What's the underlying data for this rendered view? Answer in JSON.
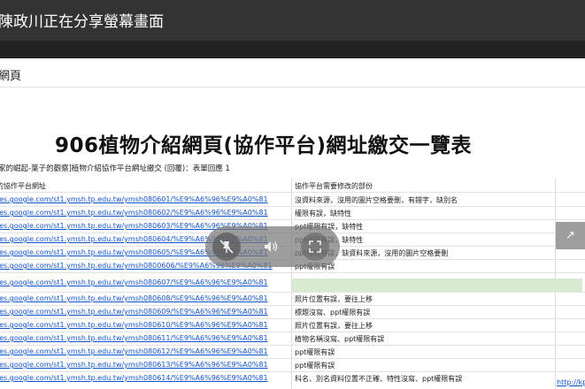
{
  "meeting": {
    "share_banner": "陳政川正在分享螢幕畫面"
  },
  "page": {
    "label": "網頁",
    "heading": "906植物介紹網頁(協作平台)網址繳交一覽表",
    "sheet_caption": "家的崛起-葉子的觀察]植物介紹協作平台網址繳交 (回覆)：表單回應 1"
  },
  "table": {
    "headers": [
      "的協作平台網址",
      "協作平台需要修改的部份"
    ],
    "rows": [
      {
        "url": "tes.google.com/st1.ymsh.tp.edu.tw/ymsh080601/%E9%A6%96%E9%A0%81",
        "note": "沒資料來源，沒用的圖片空格要刪，有錯字，缺別名"
      },
      {
        "url": "tes.google.com/st1.ymsh.tp.edu.tw/ymsh080602/%E9%A6%96%E9%A0%81",
        "note": "權限有誤，缺特性"
      },
      {
        "url": "tes.google.com/st1.ymsh.tp.edu.tw/ymsh080603/%E9%A6%96%E9%A0%81",
        "note": "ppt權限有誤，缺特性"
      },
      {
        "url": "tes.google.com/st1.ymsh.tp.edu.tw/ymsh080604/%E9%A6%96%E9%A0%81",
        "note": "ppt權限有誤，缺特性"
      },
      {
        "url": "tes.google.com/st1.ymsh.tp.edu.tw/ymsh080605/%E9%A6%96%E9%A0%81",
        "note": "ppt權限有誤，缺資料來源，沒用的圖片空格要刪"
      },
      {
        "url": "tes.google.com/st1.ymsh.tp.edu.tw/ymsh0800606/%E9%A6%96%E9%A0%81",
        "note": "ppt權限有誤"
      },
      {
        "url": "tes.google.com/st1.ymsh.tp.edu.tw/ymsh080607/%E9%A6%96%E9%A0%81",
        "note": ""
      },
      {
        "url": "tes.google.com/st1.ymsh.tp.edu.tw/ymsh080608/%E9%A6%96%E9%A0%81",
        "note": "照片位置有誤，要往上移"
      },
      {
        "url": "tes.google.com/st1.ymsh.tp.edu.tw/ymsh080609/%E9%A6%96%E9%A0%81",
        "note": "標題沒寫、ppt權限有誤"
      },
      {
        "url": "tes.google.com/st1.ymsh.tp.edu.tw/ymsh080610/%E9%A6%96%E9%A0%81",
        "note": "照片位置有誤，要往上移"
      },
      {
        "url": "tes.google.com/st1.ymsh.tp.edu.tw/ymsh080611/%E9%A6%96%E9%A0%81",
        "note": "植物名稱沒寫、ppt權限有誤"
      },
      {
        "url": "tes.google.com/st1.ymsh.tp.edu.tw/ymsh080612/%E9%A6%96%E9%A0%81",
        "note": "ppt權限有誤"
      },
      {
        "url": "tes.google.com/st1.ymsh.tp.edu.tw/ymsh080613/%E9%A6%96%E9%A0%81",
        "note": "ppt權限有誤"
      },
      {
        "url": "tes.google.com/st1.ymsh.tp.edu.tw/ymsh080614/%E9%A6%96%E9%A0%81",
        "note": "科名、別名資料位置不正確、特性沒寫、ppt權限有誤"
      }
    ],
    "far_link": "http://kp"
  },
  "overlay": {
    "icons": [
      "pin-off-icon",
      "volume-icon",
      "fullscreen-icon"
    ]
  },
  "colors": {
    "link": "#1155cc",
    "highlight_row": "#d9ead3",
    "banner_bg": "#333333"
  }
}
